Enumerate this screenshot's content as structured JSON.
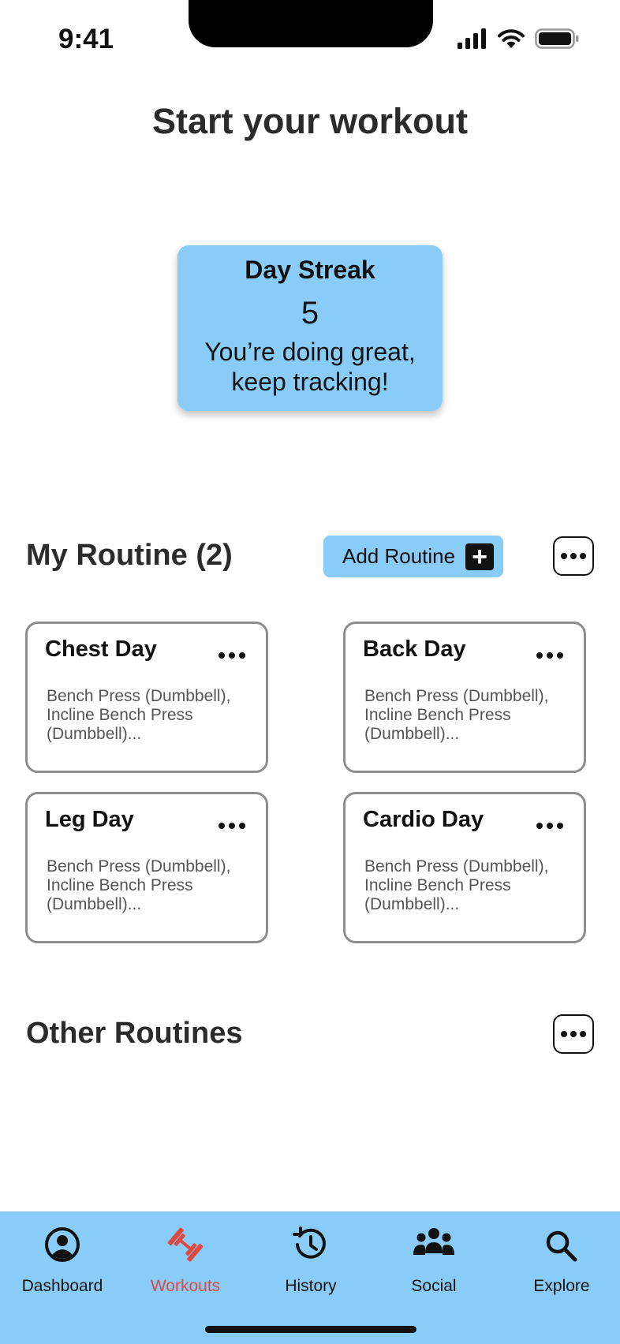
{
  "status_bar": {
    "time": "9:41"
  },
  "header": {
    "title": "Start your workout"
  },
  "streak": {
    "title": "Day Streak",
    "count": "5",
    "message": "You’re doing great, keep tracking!"
  },
  "my_routines": {
    "title": "My Routine (2)",
    "add_label": "Add Routine",
    "add_icon": "plus-icon",
    "more_icon": "more-dots-icon",
    "cards": [
      {
        "name": "Chest Day",
        "exercises": "Bench Press (Dumbbell), Incline Bench Press (Dumbbell)..."
      },
      {
        "name": "Back Day",
        "exercises": "Bench Press (Dumbbell), Incline Bench Press (Dumbbell)..."
      },
      {
        "name": "Leg Day",
        "exercises": "Bench Press (Dumbbell), Incline Bench Press (Dumbbell)..."
      },
      {
        "name": "Cardio Day",
        "exercises": "Bench Press (Dumbbell), Incline Bench Press (Dumbbell)..."
      }
    ]
  },
  "other_routines": {
    "title": "Other Routines",
    "more_icon": "more-dots-icon"
  },
  "nav": {
    "items": [
      {
        "label": "Dashboard",
        "icon": "user-circle-icon",
        "active": false
      },
      {
        "label": "Workouts",
        "icon": "dumbbell-icon",
        "active": true
      },
      {
        "label": "History",
        "icon": "history-icon",
        "active": false
      },
      {
        "label": "Social",
        "icon": "group-icon",
        "active": false
      },
      {
        "label": "Explore",
        "icon": "search-icon",
        "active": false
      }
    ]
  },
  "colors": {
    "accent_blue": "#89ccf7",
    "active_nav": "#e0493f",
    "card_border": "#8e8e8e",
    "text_dark": "#2b2b2b"
  }
}
